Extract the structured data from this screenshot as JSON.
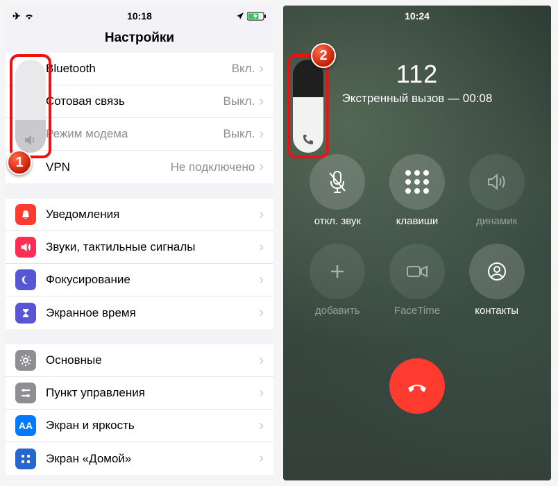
{
  "left": {
    "status": {
      "time": "10:18"
    },
    "title": "Настройки",
    "badge": "1",
    "group1": [
      {
        "label": "Bluetooth",
        "value": "Вкл.",
        "icon": "bluetooth",
        "color": "ic-blue"
      },
      {
        "label": "Сотовая связь",
        "value": "Выкл.",
        "icon": "antenna",
        "color": "ic-green"
      },
      {
        "label": "Режим модема",
        "value": "Выкл.",
        "icon": "link",
        "color": "ic-green",
        "disabled": true
      },
      {
        "label": "VPN",
        "value": "Не подключено",
        "icon": "vpn",
        "color": "ic-blue"
      }
    ],
    "group2": [
      {
        "label": "Уведомления",
        "icon": "bell",
        "color": "ic-red"
      },
      {
        "label": "Звуки, тактильные сигналы",
        "icon": "speaker",
        "color": "ic-redpink"
      },
      {
        "label": "Фокусирование",
        "icon": "moon",
        "color": "ic-indigo"
      },
      {
        "label": "Экранное время",
        "icon": "hourglass",
        "color": "ic-indigo"
      }
    ],
    "group3": [
      {
        "label": "Основные",
        "icon": "gear",
        "color": "ic-gray"
      },
      {
        "label": "Пункт управления",
        "icon": "sliders",
        "color": "ic-gray"
      },
      {
        "label": "Экран и яркость",
        "icon": "aa",
        "color": "ic-blue"
      },
      {
        "label": "Экран «Домой»",
        "icon": "grid",
        "color": "ic-bluegrid"
      }
    ]
  },
  "right": {
    "status": {
      "time": "10:24"
    },
    "badge": "2",
    "number": "112",
    "subtitle": "Экстренный вызов — 00:08",
    "buttons": {
      "mute": "откл. звук",
      "keypad": "клавиши",
      "speaker": "динамик",
      "add": "добавить",
      "facetime": "FaceTime",
      "contacts": "контакты"
    }
  }
}
